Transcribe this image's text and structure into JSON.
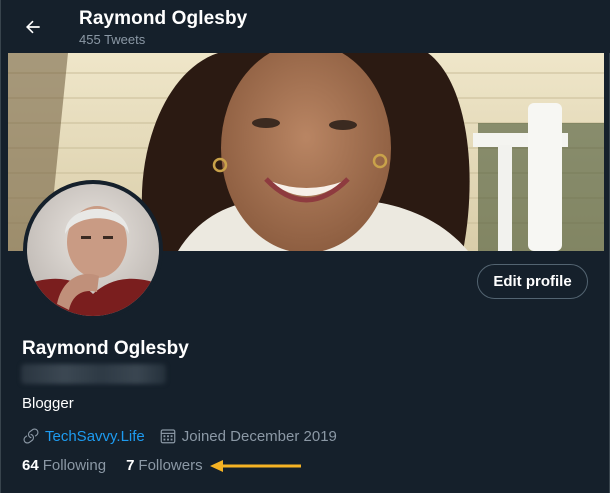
{
  "header": {
    "title": "Raymond Oglesby",
    "subtitle": "455 Tweets",
    "back_icon": "arrow-left-icon"
  },
  "profile": {
    "name": "Raymond Oglesby",
    "bio": "Blogger",
    "edit_label": "Edit profile",
    "link_text": "TechSavvy.Life",
    "joined": "Joined December 2019",
    "following_count": "64",
    "following_label": "Following",
    "followers_count": "7",
    "followers_label": "Followers"
  },
  "colors": {
    "background": "#15202b",
    "link": "#1d9bf0",
    "muted": "#8b98a5",
    "annotation_arrow": "#f5b324"
  }
}
